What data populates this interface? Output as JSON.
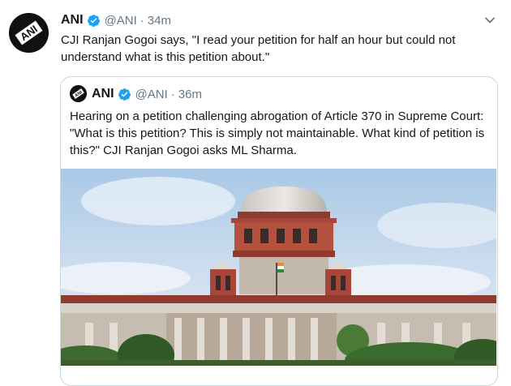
{
  "tweet": {
    "author": "ANI",
    "handle": "@ANI",
    "separator": "·",
    "time": "34m",
    "text": "CJI Ranjan Gogoi says, \"I read your petition for half an hour but could not understand what is this petition about.\""
  },
  "quoted": {
    "author": "ANI",
    "handle": "@ANI",
    "separator": "·",
    "time": "36m",
    "text": "Hearing on a petition challenging abrogation of Article 370 in Supreme Court: \"What is this petition? This is simply not maintainable. What kind of petition is this?\" CJI Ranjan Gogoi asks ML Sharma."
  },
  "colors": {
    "verified": "#1da1f2",
    "meta": "#657786",
    "border": "#ccd6dd"
  },
  "icons": {
    "menu": "chevron-down-icon",
    "verified": "verified-badge-icon"
  }
}
